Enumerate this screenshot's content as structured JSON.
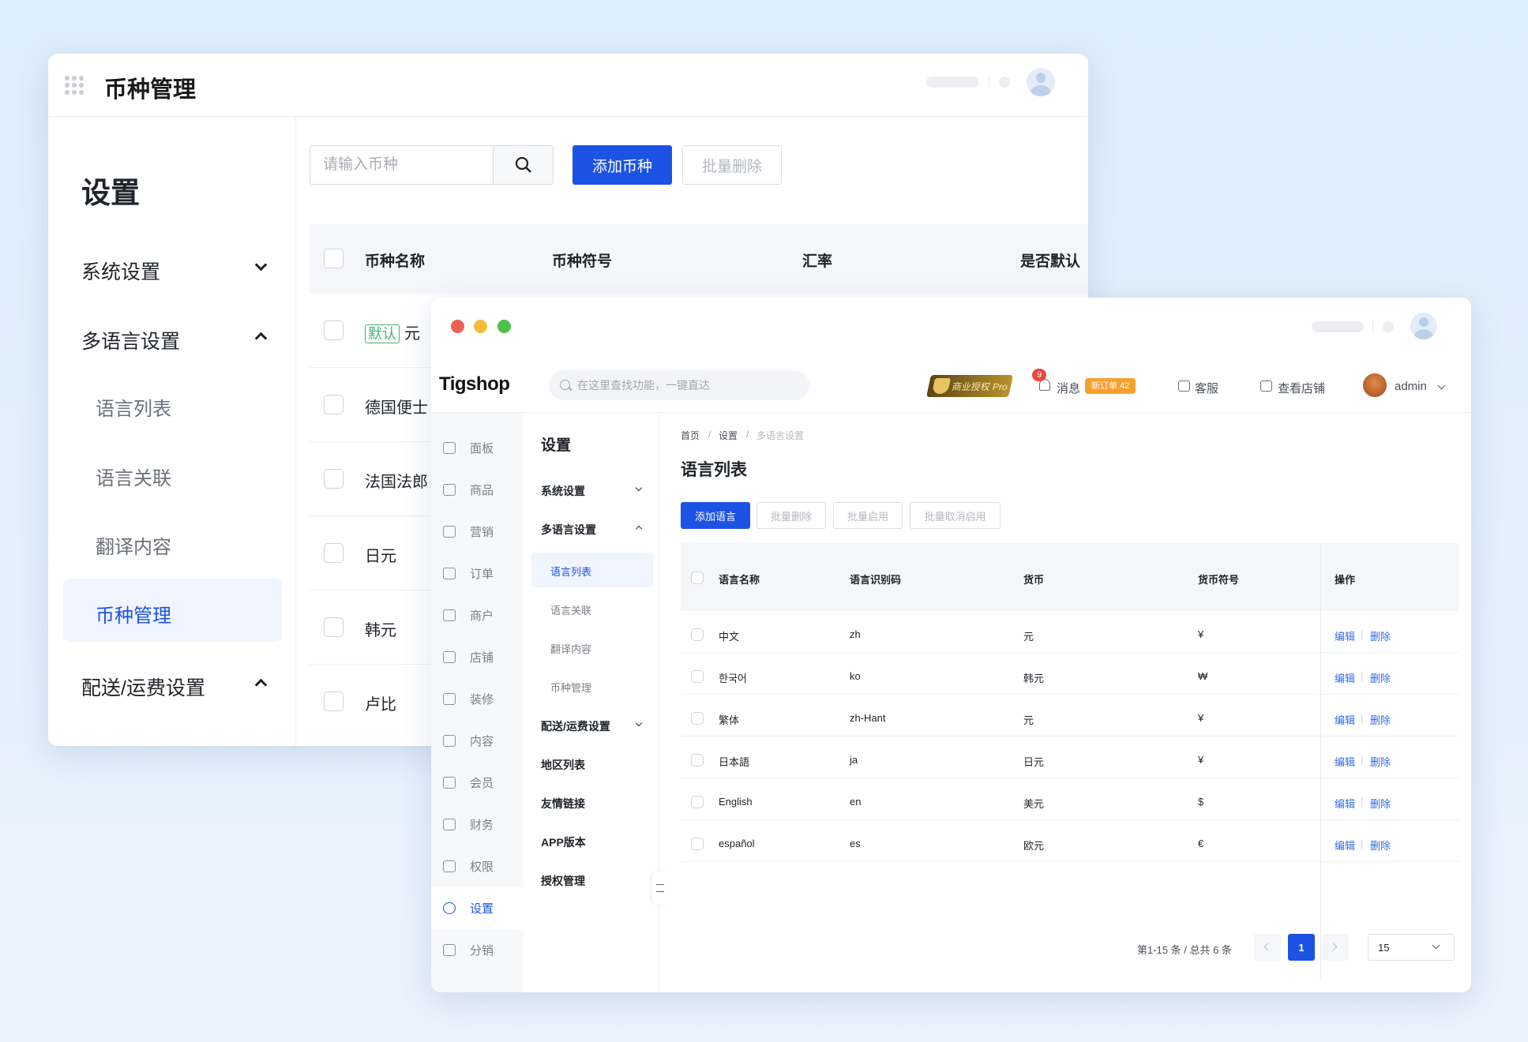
{
  "back": {
    "title": "币种管理",
    "sidebar": {
      "heading": "设置",
      "items": [
        {
          "label": "系统设置"
        },
        {
          "label": "多语言设置"
        },
        {
          "label": "语言列表"
        },
        {
          "label": "语言关联"
        },
        {
          "label": "翻译内容"
        },
        {
          "label": "币种管理"
        },
        {
          "label": "配送/运费设置"
        }
      ]
    },
    "search": {
      "placeholder": "请输入币种"
    },
    "add_button": "添加币种",
    "batch_delete_button": "批量删除",
    "table": {
      "headers": [
        "币种名称",
        "币种符号",
        "汇率",
        "是否默认"
      ],
      "default_tag": "默认",
      "rows": [
        "元",
        "德国便士",
        "法国法郎",
        "日元",
        "韩元",
        "卢比"
      ]
    }
  },
  "front": {
    "logo": "Tigshop",
    "global_search": {
      "placeholder": "在这里查找功能，一键直达"
    },
    "license_badge": "商业授权 Pro",
    "messages": {
      "label": "消息",
      "count": "9",
      "new_orders": "新订单 42"
    },
    "service": "客服",
    "view_store": "查看店铺",
    "user": "admin",
    "rail": [
      "面板",
      "商品",
      "营销",
      "订单",
      "商户",
      "店铺",
      "装修",
      "内容",
      "会员",
      "财务",
      "权限",
      "设置",
      "分销"
    ],
    "submenu": {
      "heading": "设置",
      "items": [
        "系统设置",
        "多语言设置",
        "语言列表",
        "语言关联",
        "翻译内容",
        "币种管理",
        "配送/运费设置",
        "地区列表",
        "友情链接",
        "APP版本",
        "授权管理"
      ]
    },
    "breadcrumb": [
      "首页",
      "设置",
      "多语言设置"
    ],
    "page_title": "语言列表",
    "buttons": [
      "添加语言",
      "批量删除",
      "批量启用",
      "批量取消启用"
    ],
    "table": {
      "headers": [
        "语言名称",
        "语言识别码",
        "货币",
        "货币符号",
        "操作"
      ],
      "rows": [
        {
          "name": "中文",
          "code": "zh",
          "currency": "元",
          "symbol": "¥"
        },
        {
          "name": "한국어",
          "code": "ko",
          "currency": "韩元",
          "symbol": "₩"
        },
        {
          "name": "繁体",
          "code": "zh-Hant",
          "currency": "元",
          "symbol": "¥"
        },
        {
          "name": "日本語",
          "code": "ja",
          "currency": "日元",
          "symbol": "¥"
        },
        {
          "name": "English",
          "code": "en",
          "currency": "美元",
          "symbol": "$"
        },
        {
          "name": "español",
          "code": "es",
          "currency": "欧元",
          "symbol": "€"
        }
      ],
      "edit": "编辑",
      "delete": "删除"
    },
    "pagination": {
      "summary": "第1-15 条 / 总共 6 条",
      "page": "1",
      "page_size": "15"
    }
  }
}
